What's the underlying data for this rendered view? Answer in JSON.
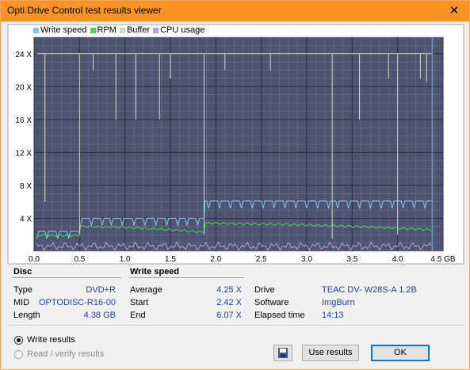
{
  "window": {
    "title": "Opti Drive Control test results viewer",
    "close_glyph": "✕"
  },
  "legend": [
    {
      "label": "Write speed",
      "color": "#7fc6f5"
    },
    {
      "label": "RPM",
      "color": "#4cd64c"
    },
    {
      "label": "Buffer",
      "color": "#d8d8b8"
    },
    {
      "label": "CPU usage",
      "color": "#c89ad8"
    }
  ],
  "chart_data": {
    "type": "line",
    "x_unit": "GB",
    "xlim": [
      0,
      4.5
    ],
    "ylim": [
      0,
      26
    ],
    "x_ticks": [
      "0.0",
      "0.5",
      "1.0",
      "1.5",
      "2.0",
      "2.5",
      "3.0",
      "3.5",
      "4.0",
      "4.5 GB"
    ],
    "y_ticks": [
      "4 X",
      "8 X",
      "12 X",
      "16 X",
      "20 X",
      "24 X"
    ],
    "y_tick_values": [
      4,
      8,
      12,
      16,
      20,
      24
    ],
    "x_tick_values": [
      0,
      0.5,
      1.0,
      1.5,
      2.0,
      2.5,
      3.0,
      3.5,
      4.0,
      4.5
    ],
    "grid": true,
    "background": "#4d5470",
    "end_marker_x": 4.38,
    "series": [
      {
        "name": "Write speed",
        "color": "#7fc6f5",
        "x": [
          0.03,
          0.1,
          0.5,
          0.51,
          1.0,
          1.5,
          1.87,
          1.88,
          2.5,
          3.0,
          3.5,
          3.6,
          4.0,
          4.38
        ],
        "y": [
          2.42,
          2.42,
          2.42,
          4.0,
          4.0,
          4.0,
          4.0,
          6.1,
          6.1,
          6.1,
          6.1,
          6.1,
          6.1,
          6.07
        ]
      },
      {
        "name": "RPM",
        "color": "#4cd64c",
        "x": [
          0.03,
          0.5,
          0.51,
          1.0,
          1.5,
          1.87,
          1.88,
          2.5,
          3.0,
          3.5,
          4.0,
          4.38
        ],
        "y": [
          1.9,
          1.9,
          3.0,
          2.9,
          2.6,
          2.3,
          3.4,
          3.3,
          3.2,
          3.0,
          2.8,
          2.6
        ]
      },
      {
        "name": "Buffer",
        "color": "#d8d8b8",
        "x": [
          0.03,
          4.38
        ],
        "y": [
          24,
          24
        ],
        "dips": [
          {
            "x": 0.12,
            "y": 6.0
          },
          {
            "x": 0.5,
            "y": 2.0
          },
          {
            "x": 0.65,
            "y": 22.0
          },
          {
            "x": 0.9,
            "y": 16.0
          },
          {
            "x": 1.12,
            "y": 16.0
          },
          {
            "x": 1.38,
            "y": 16.0
          },
          {
            "x": 1.5,
            "y": 21.0
          },
          {
            "x": 1.87,
            "y": 2.0
          },
          {
            "x": 2.1,
            "y": 22.0
          },
          {
            "x": 2.6,
            "y": 22.0
          },
          {
            "x": 3.28,
            "y": 1.5
          },
          {
            "x": 3.58,
            "y": 16.0
          },
          {
            "x": 3.9,
            "y": 21.0
          },
          {
            "x": 4.0,
            "y": 2.0
          },
          {
            "x": 4.25,
            "y": 21.0
          },
          {
            "x": 4.32,
            "y": 20.5
          }
        ]
      },
      {
        "name": "CPU usage",
        "color": "#c89ad8",
        "x": [
          0.03,
          4.38
        ],
        "y": [
          0.6,
          0.6
        ]
      }
    ]
  },
  "disc": {
    "heading": "Disc",
    "rows": [
      {
        "label": "Type",
        "value": "DVD+R"
      },
      {
        "label": "MID",
        "value": "OPTODISC-R16-00"
      },
      {
        "label": "Length",
        "value": "4.38 GB"
      }
    ]
  },
  "write_speed": {
    "heading": "Write speed",
    "rows": [
      {
        "label": "Average",
        "value": "4.25 X"
      },
      {
        "label": "Start",
        "value": "2.42 X"
      },
      {
        "label": "End",
        "value": "6.07 X"
      }
    ]
  },
  "drive_info": {
    "rows": [
      {
        "label": "Drive",
        "value": "TEAC DV- W28S-A 1.2B"
      },
      {
        "label": "Software",
        "value": "ImgBurn"
      },
      {
        "label": "Elapsed time",
        "value": "14:13"
      }
    ]
  },
  "options": {
    "write_results": "Write results",
    "read_verify_results": "Read / verify results"
  },
  "buttons": {
    "use_results": "Use results",
    "ok": "OK"
  }
}
